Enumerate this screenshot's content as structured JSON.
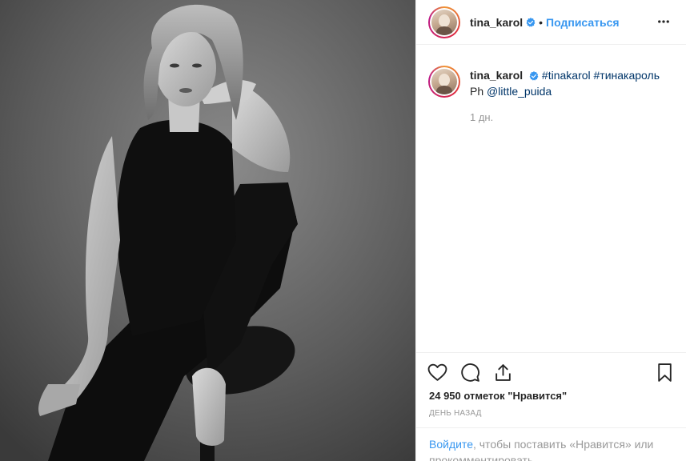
{
  "post": {
    "username": "tina_karol",
    "dot": "•",
    "follow_label": "Подписаться",
    "more_icon": "more-horizontal-icon",
    "photo_alt": "black-and-white portrait photo"
  },
  "caption": {
    "username": "tina_karol",
    "hashtags": [
      "#tinakarol",
      "#тинакароль"
    ],
    "credit_prefix": "Ph",
    "credit_mention": "@little_puida",
    "time": "1 дн."
  },
  "actions": {
    "icons": [
      "heart-icon",
      "comment-icon",
      "share-icon",
      "bookmark-icon"
    ]
  },
  "likes": "24 950 отметок \"Нравится\"",
  "date": "День назад",
  "login": {
    "link": "Войдите",
    "text": ", чтобы поставить «Нравится» или прокомментировать."
  },
  "colors": {
    "link_blue": "#3897f0",
    "hashtag_blue": "#003569",
    "muted": "#999999",
    "verified": "#3897f0"
  }
}
